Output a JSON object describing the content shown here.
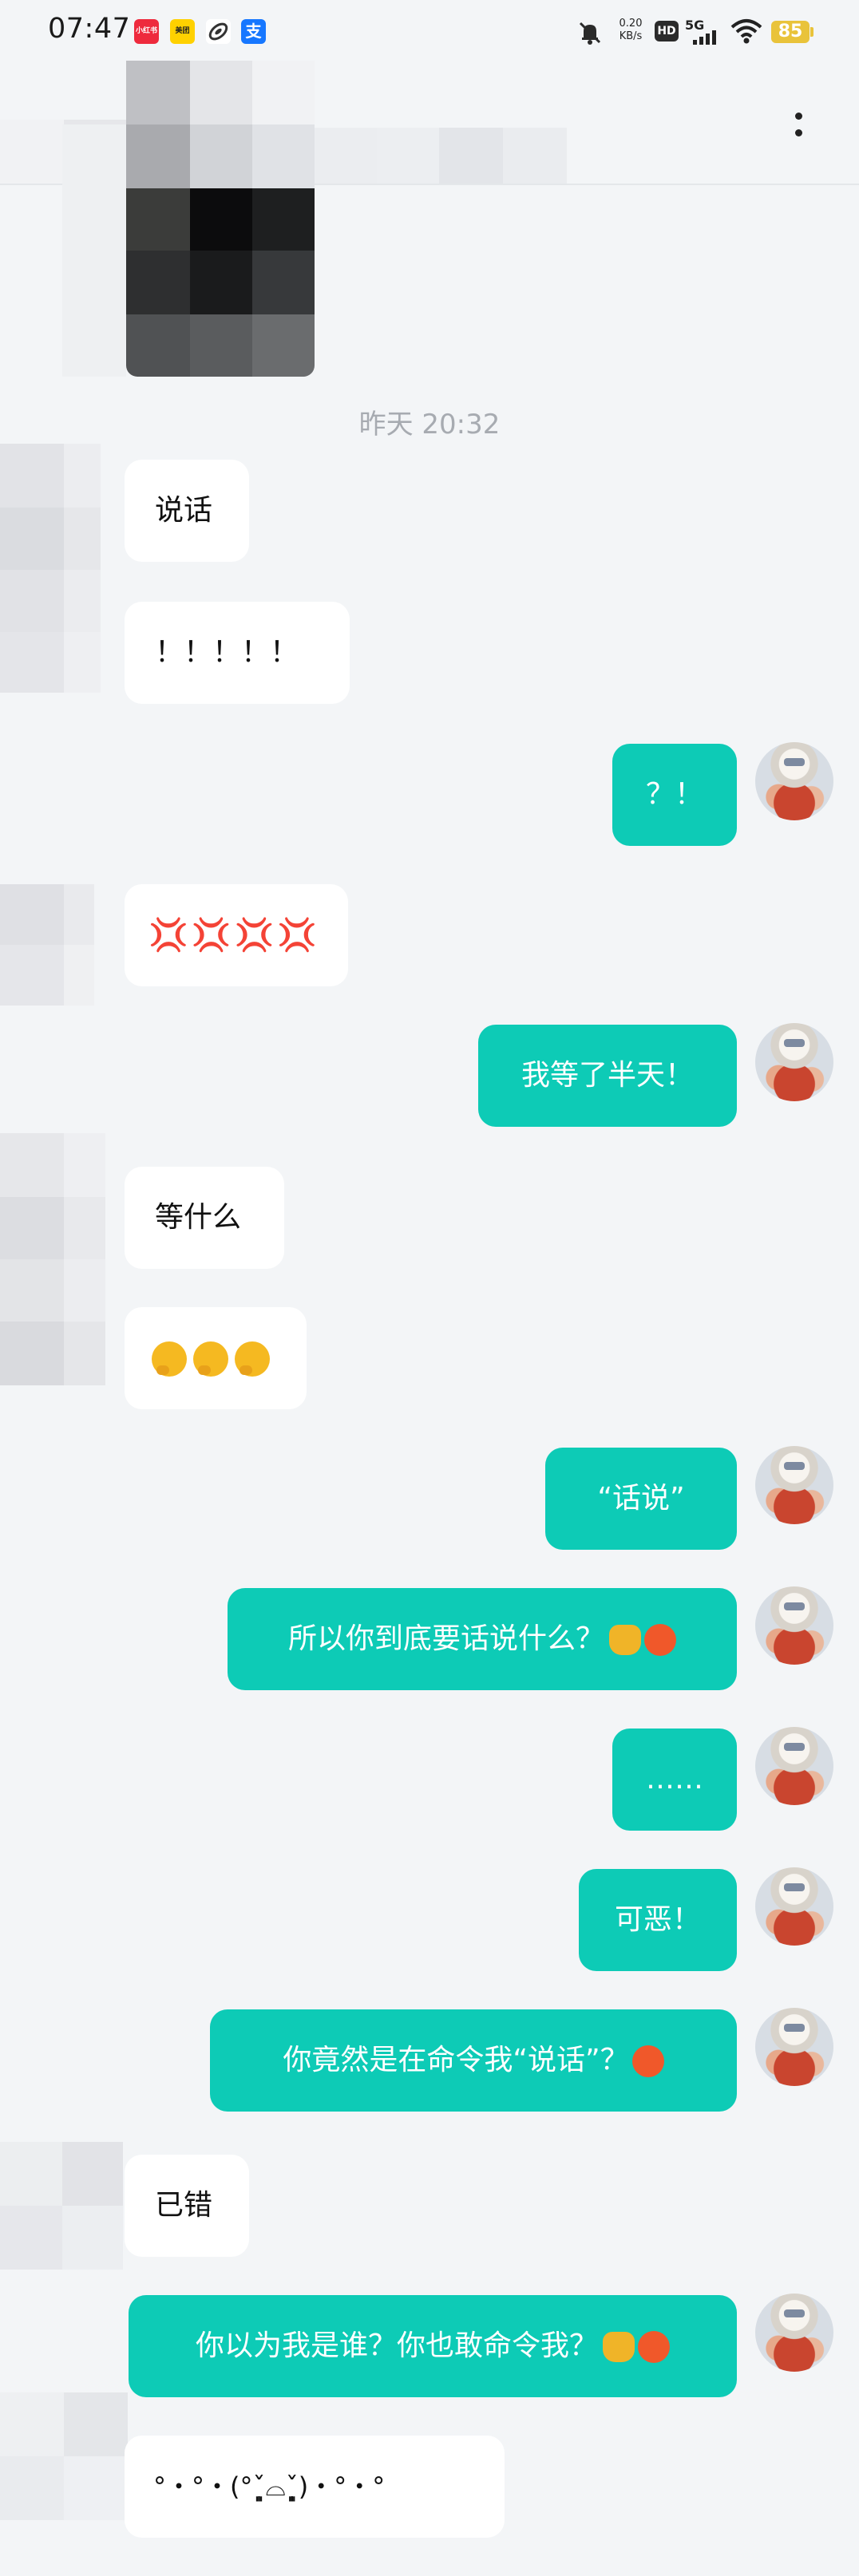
{
  "status_bar": {
    "time": "07:47",
    "apps": {
      "xhs": "小红书",
      "meituan": "美团",
      "alipay": "支"
    },
    "speed_value": "0.20",
    "speed_unit": "KB/s",
    "hd": "HD",
    "network": "5G",
    "battery": "85",
    "icons": [
      "mute-bell-icon",
      "hd-icon",
      "signal-5g-icon",
      "wifi-icon",
      "battery-icon"
    ]
  },
  "header": {
    "icons": [
      "more-icon"
    ]
  },
  "chat": {
    "timestamp": "昨天  20:32",
    "messages": [
      {
        "side": "in",
        "text": "说话"
      },
      {
        "side": "in",
        "text": "！！！！！"
      },
      {
        "side": "out",
        "text": "？！"
      },
      {
        "side": "in",
        "text": "💢💢💢💢"
      },
      {
        "side": "out",
        "text": "我等了半天！"
      },
      {
        "side": "in",
        "text": "等什么"
      },
      {
        "side": "in",
        "emoji": "🤔🤔🤔"
      },
      {
        "side": "out",
        "text": "“话说”"
      },
      {
        "side": "out",
        "text": "所以你到底要话说什么？"
      },
      {
        "side": "out",
        "text": "……"
      },
      {
        "side": "out",
        "text": "可恶！"
      },
      {
        "side": "out",
        "text": "你竟然是在命令我“说话”？"
      },
      {
        "side": "in",
        "text": "已错"
      },
      {
        "side": "out",
        "text": "你以为我是谁？你也敢命令我？"
      },
      {
        "side": "in",
        "text": "°・°・(°ˇ̩̩̩̩̩̩͈⌓ˇ̩̩̩̩̩̩͈)・°・°"
      }
    ]
  },
  "colors": {
    "background": "#f3f5f7",
    "outgoing_bubble": "#0dcbb6",
    "incoming_bubble": "#ffffff",
    "timestamp_text": "#a7abb1",
    "battery": "#e9c33a"
  }
}
